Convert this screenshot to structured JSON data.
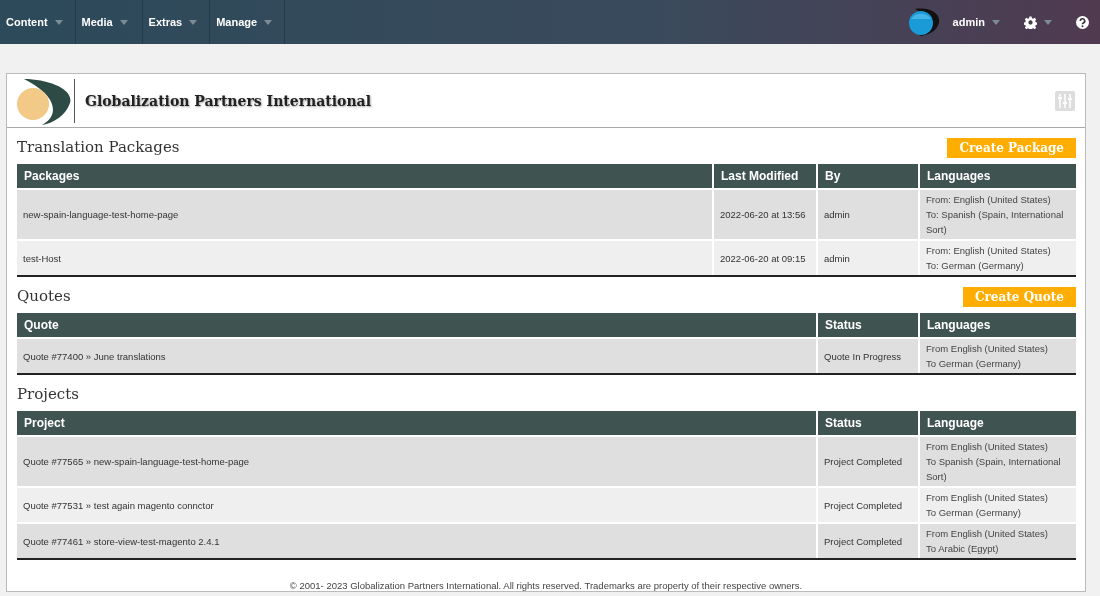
{
  "nav": {
    "menus": [
      "Content",
      "Media",
      "Extras",
      "Manage"
    ],
    "user": "admin"
  },
  "header": {
    "company": "Globalization Partners International"
  },
  "sections": [
    {
      "title": "Translation Packages",
      "button": "Create Package",
      "columns": [
        "Packages",
        "Last Modified",
        "By",
        "Languages"
      ],
      "rows": [
        {
          "cells": [
            "new-spain-language-test-home-page",
            "2022-06-20 at 13:56",
            "admin"
          ],
          "languages": [
            "From: English (United States)",
            "To: Spanish (Spain, International Sort)"
          ]
        },
        {
          "cells": [
            "test-Host",
            "2022-06-20 at 09:15",
            "admin"
          ],
          "languages": [
            "From: English (United States)",
            "To: German (Germany)"
          ]
        }
      ]
    },
    {
      "title": "Quotes",
      "button": "Create Quote",
      "columns": [
        "Quote",
        "Status",
        "Languages"
      ],
      "rows": [
        {
          "cells": [
            "Quote #77400 » June translations",
            "Quote In Progress"
          ],
          "languages": [
            "From English (United States)",
            "To German (Germany)"
          ]
        }
      ]
    },
    {
      "title": "Projects",
      "columns": [
        "Project",
        "Status",
        "Language"
      ],
      "rows": [
        {
          "cells": [
            "Quote #77565 » new-spain-language-test-home-page",
            "Project Completed"
          ],
          "languages": [
            "From English (United States)",
            "To Spanish (Spain, International Sort)"
          ]
        },
        {
          "cells": [
            "Quote #77531 » test again magento connctor",
            "Project Completed"
          ],
          "languages": [
            "From English (United States)",
            "To German (Germany)"
          ]
        },
        {
          "cells": [
            "Quote #77461 » store-view-test-magento 2.4.1",
            "Project Completed"
          ],
          "languages": [
            "From English (United States)",
            "To Arabic (Egypt)"
          ]
        }
      ]
    }
  ],
  "footer": "© 2001- 2023 Globalization Partners International. All rights reserved. Trademarks are property of their respective owners."
}
